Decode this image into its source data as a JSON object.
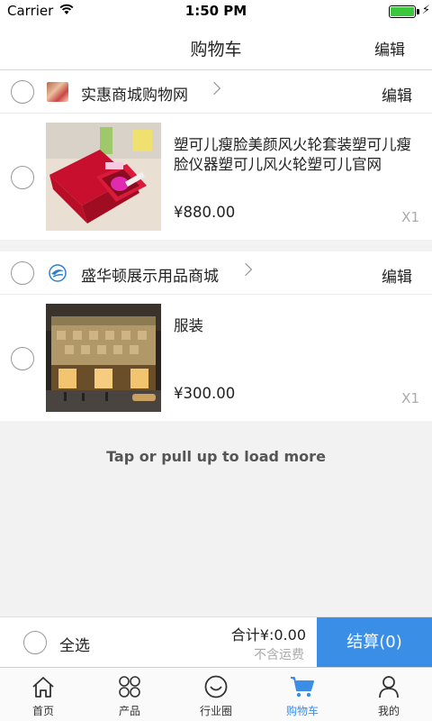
{
  "status_bar": {
    "carrier": "Carrier",
    "time": "1:50 PM"
  },
  "nav": {
    "title": "购物车",
    "edit_label": "编辑"
  },
  "shops": [
    {
      "name": "实惠商城购物网",
      "edit_label": "编辑",
      "logo_icon": "shop-logo-photo",
      "products": [
        {
          "title": "塑可儿瘦脸美颜风火轮套装塑可儿瘦脸仪器塑可儿风火轮塑可儿官网",
          "price": "¥880.00",
          "quantity": "X1"
        }
      ]
    },
    {
      "name": "盛华顿展示用品商城",
      "edit_label": "编辑",
      "logo_icon": "shop-logo-swirl",
      "products": [
        {
          "title": "服装",
          "price": "¥300.00",
          "quantity": "X1"
        }
      ]
    }
  ],
  "load_more": "Tap or pull up to load more",
  "checkout": {
    "select_all_label": "全选",
    "total_label": "合计¥:0.00",
    "shipping_note": "不含运费",
    "checkout_label": "结算(0)"
  },
  "tabs": [
    {
      "label": "首页",
      "icon": "home-icon",
      "active": false
    },
    {
      "label": "产品",
      "icon": "grid-icon",
      "active": false
    },
    {
      "label": "行业圈",
      "icon": "smile-icon",
      "active": false
    },
    {
      "label": "购物车",
      "icon": "cart-icon",
      "active": true
    },
    {
      "label": "我的",
      "icon": "user-icon",
      "active": false
    }
  ],
  "colors": {
    "accent": "#3a8ee6",
    "background": "#f2f2f2",
    "battery": "#3cc83c"
  }
}
